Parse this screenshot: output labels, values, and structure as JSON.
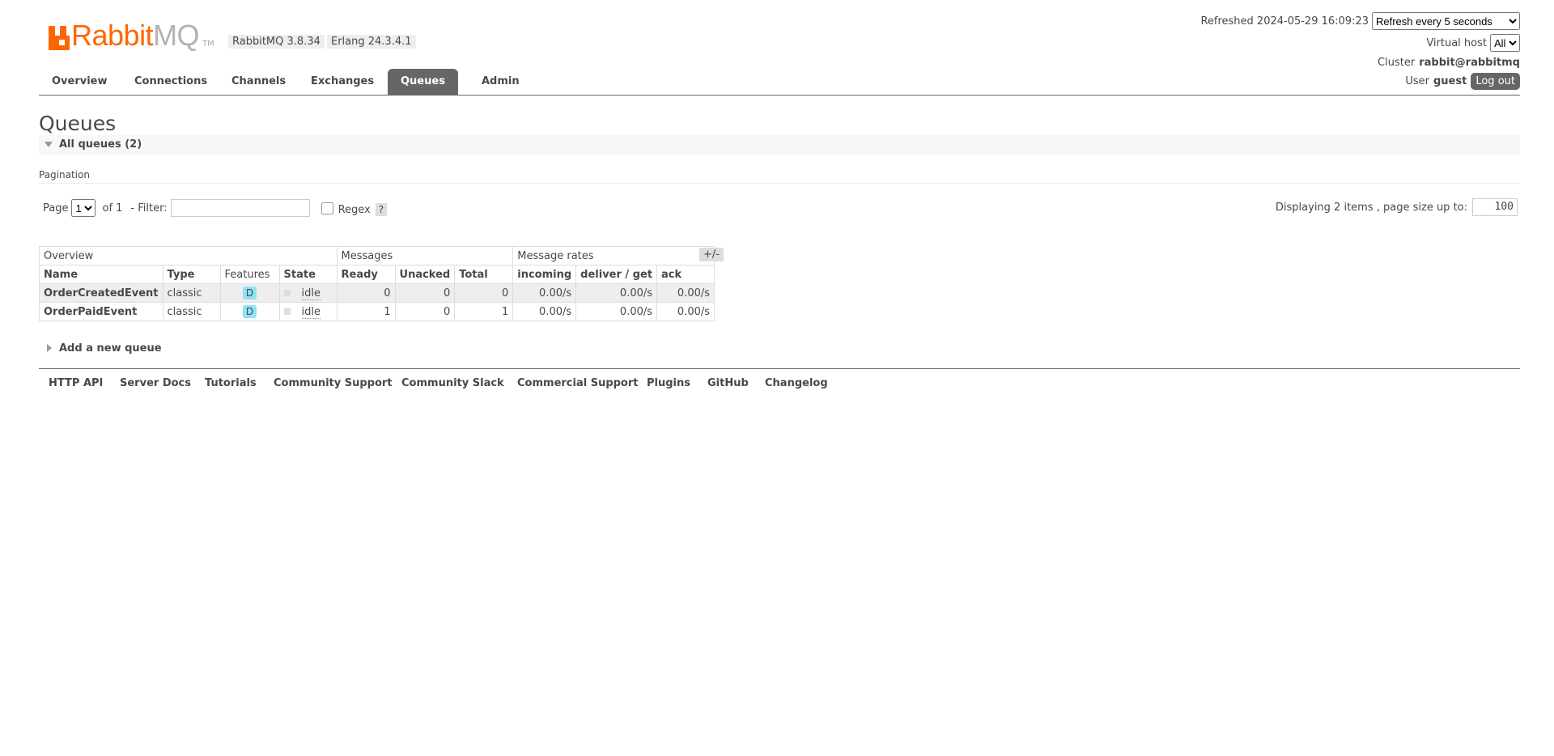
{
  "header": {
    "logo": {
      "rabbit": "Rabbit",
      "mq": "MQ",
      "tm": "TM"
    },
    "rabbitmq_version": "RabbitMQ 3.8.34",
    "erlang_version": "Erlang 24.3.4.1",
    "refreshed_label": "Refreshed 2024-05-29 16:09:23",
    "refresh_select": "Refresh every 5 seconds",
    "virtual_host_label": "Virtual host",
    "virtual_host_select": "All",
    "cluster_label": "Cluster",
    "cluster_name": "rabbit@rabbitmq",
    "user_label": "User",
    "user_name": "guest",
    "logout_label": "Log out"
  },
  "tabs": [
    {
      "label": "Overview",
      "active": false
    },
    {
      "label": "Connections",
      "active": false
    },
    {
      "label": "Channels",
      "active": false
    },
    {
      "label": "Exchanges",
      "active": false
    },
    {
      "label": "Queues",
      "active": true
    },
    {
      "label": "Admin",
      "active": false
    }
  ],
  "page_title": "Queues",
  "section_title": "All queues (2)",
  "pagination": {
    "title": "Pagination",
    "page_label": "Page",
    "page_select": "1",
    "of_label": "of 1",
    "filter_label": "- Filter:",
    "filter_value": "",
    "regex_label": "Regex",
    "help_label": "?",
    "displaying_label": "Displaying 2 items , page size up to:",
    "page_size": "100"
  },
  "table": {
    "groups": [
      "Overview",
      "Messages",
      "Message rates"
    ],
    "columns": [
      "Name",
      "Type",
      "Features",
      "State",
      "Ready",
      "Unacked",
      "Total",
      "incoming",
      "deliver / get",
      "ack"
    ],
    "plus_minus": "+/-",
    "rows": [
      {
        "name": "OrderCreatedEvent",
        "type": "classic",
        "features": "D",
        "state": "idle",
        "ready": "0",
        "unacked": "0",
        "total": "0",
        "incoming": "0.00/s",
        "deliver_get": "0.00/s",
        "ack": "0.00/s"
      },
      {
        "name": "OrderPaidEvent",
        "type": "classic",
        "features": "D",
        "state": "idle",
        "ready": "1",
        "unacked": "0",
        "total": "1",
        "incoming": "0.00/s",
        "deliver_get": "0.00/s",
        "ack": "0.00/s"
      }
    ]
  },
  "add_queue_label": "Add a new queue",
  "footer": [
    "HTTP API",
    "Server Docs",
    "Tutorials",
    "Community Support",
    "Community Slack",
    "Commercial Support",
    "Plugins",
    "GitHub",
    "Changelog"
  ],
  "colors": {
    "brand": "#ff6600",
    "tab_active": "#666666",
    "badge": "#8fe3f7"
  }
}
